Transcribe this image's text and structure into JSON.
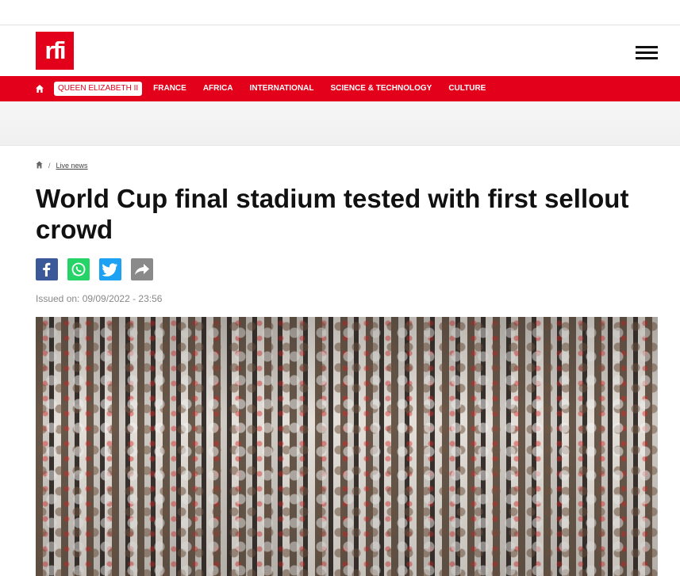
{
  "brand": {
    "logo_text": "rfi",
    "accent_color": "#e2001a"
  },
  "nav": {
    "home_icon": "home-icon",
    "items": [
      {
        "label": "QUEEN ELIZABETH II",
        "active": true
      },
      {
        "label": "FRANCE"
      },
      {
        "label": "AFRICA"
      },
      {
        "label": "INTERNATIONAL"
      },
      {
        "label": "SCIENCE & TECHNOLOGY"
      },
      {
        "label": "CULTURE"
      }
    ]
  },
  "breadcrumb": {
    "home_icon": "home-icon",
    "separator": "/",
    "link": "Live news"
  },
  "article": {
    "title": "World Cup final stadium tested with first sellout crowd",
    "issued": "Issued on: 09/09/2022 - 23:56"
  },
  "share": {
    "facebook_color": "#3b5998",
    "whatsapp_color": "#25d366",
    "twitter_color": "#1da1f2",
    "share_color": "#8a8a8a"
  }
}
